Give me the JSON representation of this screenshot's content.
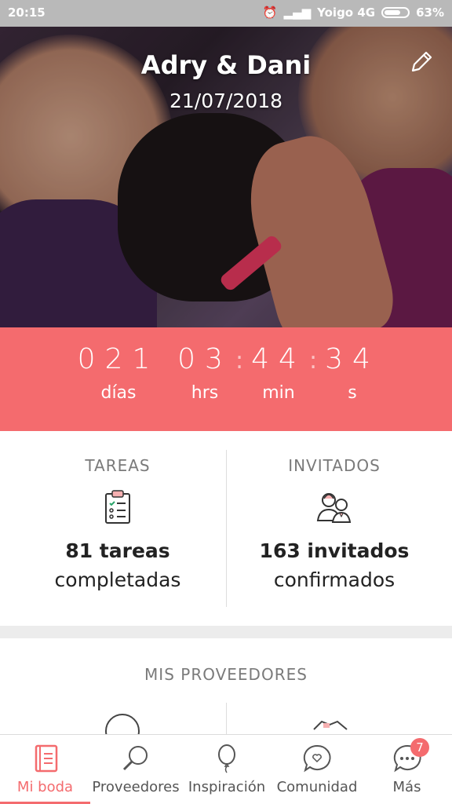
{
  "status_bar": {
    "time": "20:15",
    "carrier": "Yoigo 4G",
    "battery": "63%"
  },
  "hero": {
    "names": "Adry & Dani",
    "date": "21/07/2018",
    "edit_icon": "pencil-icon"
  },
  "countdown": {
    "days": "021",
    "days_label": "días",
    "hours": "03",
    "hours_label": "hrs",
    "minutes": "44",
    "minutes_label": "min",
    "seconds": "34",
    "seconds_label": "s",
    "separator": ":"
  },
  "stats": {
    "tasks": {
      "title": "TAREAS",
      "count": "81 tareas",
      "sub": "completadas",
      "icon": "clipboard-checklist-icon"
    },
    "guests": {
      "title": "INVITADOS",
      "count": "163 invitados",
      "sub": "confirmados",
      "icon": "guests-icon"
    }
  },
  "providers": {
    "title": "MIS PROVEEDORES"
  },
  "nav": {
    "items": [
      {
        "label": "Mi boda",
        "icon": "notebook-icon"
      },
      {
        "label": "Proveedores",
        "icon": "search-icon"
      },
      {
        "label": "Inspiración",
        "icon": "balloon-icon"
      },
      {
        "label": "Comunidad",
        "icon": "chat-heart-icon"
      },
      {
        "label": "Más",
        "icon": "more-dots-icon"
      }
    ],
    "badge": "7"
  },
  "colors": {
    "accent": "#f46b6e",
    "status_bar": "#b9b9b9"
  }
}
